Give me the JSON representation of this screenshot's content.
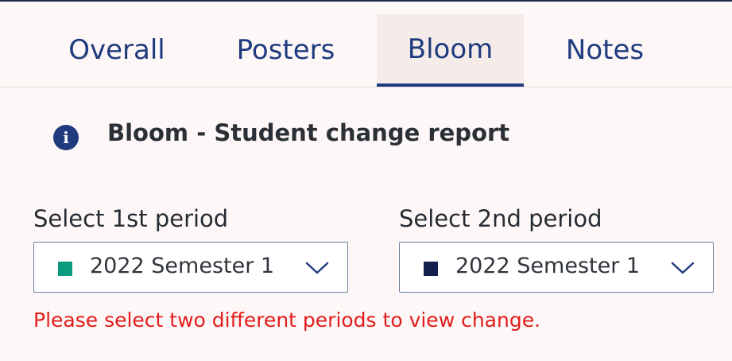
{
  "tabs": {
    "overall": "Overall",
    "posters": "Posters",
    "bloom": "Bloom",
    "notes": "Notes",
    "active": "Bloom"
  },
  "info": {
    "icon": "info-icon",
    "glyph": "i"
  },
  "report": {
    "title": "Bloom - Student change report"
  },
  "period1": {
    "label": "Select 1st period",
    "value": "2022 Semester 1",
    "swatch_color": "#0a9a80"
  },
  "period2": {
    "label": "Select 2nd period",
    "value": "2022 Semester 1",
    "swatch_color": "#13204d"
  },
  "error": {
    "message": "Please select two different periods to view change."
  },
  "colors": {
    "accent": "#1f3b7e",
    "error": "#e21b1b",
    "background": "#fdf8f7"
  }
}
